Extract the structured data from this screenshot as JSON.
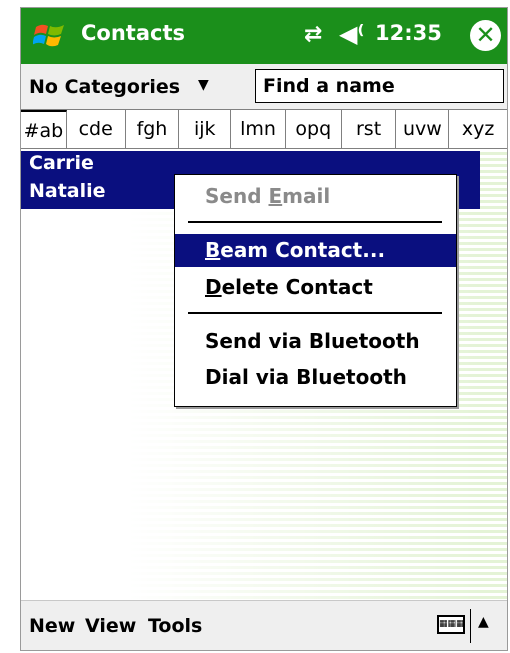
{
  "title_bar": {
    "app_title": "Contacts",
    "time": "12:35",
    "connectivity_icon": "⇄",
    "volume_icon": "◀⁽",
    "close_icon": "✕",
    "bar_color": "#1b8f1b"
  },
  "category_bar": {
    "category": "No Categories",
    "dropdown_arrow": "▼",
    "find_placeholder": "Find a name"
  },
  "letter_tabs": [
    "#ab",
    "cde",
    "fgh",
    "ijk",
    "lmn",
    "opq",
    "rst",
    "uvw",
    "xyz"
  ],
  "contacts": [
    "Carrie",
    "Natalie"
  ],
  "context_menu": {
    "send_email": {
      "pre": "Send ",
      "key": "E",
      "post": "mail",
      "enabled": false
    },
    "beam_contact": {
      "pre": "",
      "key": "B",
      "post": "eam Contact...",
      "highlighted": true
    },
    "delete_contact": {
      "pre": "",
      "key": "D",
      "post": "elete Contact"
    },
    "send_bluetooth": "Send via Bluetooth",
    "dial_bluetooth": "Dial via Bluetooth"
  },
  "menu_bar": {
    "new": "New",
    "view": "View",
    "tools": "Tools",
    "keyboard_icon": "keyboard-icon",
    "sip_arrow": "▲"
  },
  "colors": {
    "selection": "#0a0f7f",
    "bar_green": "#1b8f1b"
  }
}
